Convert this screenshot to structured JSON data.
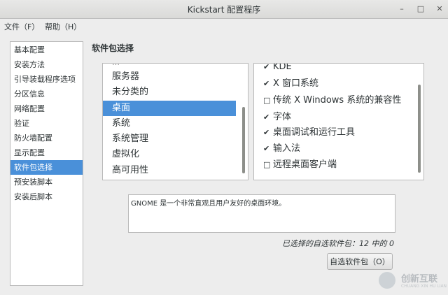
{
  "window": {
    "title": "Kickstart 配置程序",
    "controls": {
      "minimize": "–",
      "maximize": "□",
      "close": "✕"
    }
  },
  "menubar": {
    "file": "文件（F）",
    "help": "帮助（H）"
  },
  "sidebar": {
    "items": [
      {
        "label": "基本配置"
      },
      {
        "label": "安装方法"
      },
      {
        "label": "引导装载程序选项"
      },
      {
        "label": "分区信息"
      },
      {
        "label": "网络配置"
      },
      {
        "label": "验证"
      },
      {
        "label": "防火墙配置"
      },
      {
        "label": "显示配置"
      },
      {
        "label": "软件包选择",
        "selected": true
      },
      {
        "label": "预安装脚本"
      },
      {
        "label": "安装后脚本"
      }
    ]
  },
  "main": {
    "section_title": "软件包选择",
    "groups": [
      {
        "label": "服务器"
      },
      {
        "label": "未分类的"
      },
      {
        "label": "桌面",
        "selected": true
      },
      {
        "label": "系统"
      },
      {
        "label": "系统管理"
      },
      {
        "label": "虚拟化"
      },
      {
        "label": "高可用性"
      }
    ],
    "packages": [
      {
        "label": "KDE",
        "checked": true,
        "mark": "✔"
      },
      {
        "label": "X 窗口系统",
        "checked": true,
        "mark": "✔"
      },
      {
        "label": "传统 X Windows 系统的兼容性",
        "checked": false,
        "mark": "□"
      },
      {
        "label": "字体",
        "checked": true,
        "mark": "✔"
      },
      {
        "label": "桌面调试和运行工具",
        "checked": true,
        "mark": "✔"
      },
      {
        "label": "输入法",
        "checked": true,
        "mark": "✔"
      },
      {
        "label": "远程桌面客户端",
        "checked": false,
        "mark": "□"
      }
    ],
    "description": "GNOME 是一个非常直观且用户友好的桌面环境。",
    "status": "已选择的自选软件包：12 中的 0",
    "optional_button": "自选软件包（O）"
  },
  "watermark": {
    "text": "创新互联",
    "sub": "CHUANG XIN HU LIAN"
  }
}
